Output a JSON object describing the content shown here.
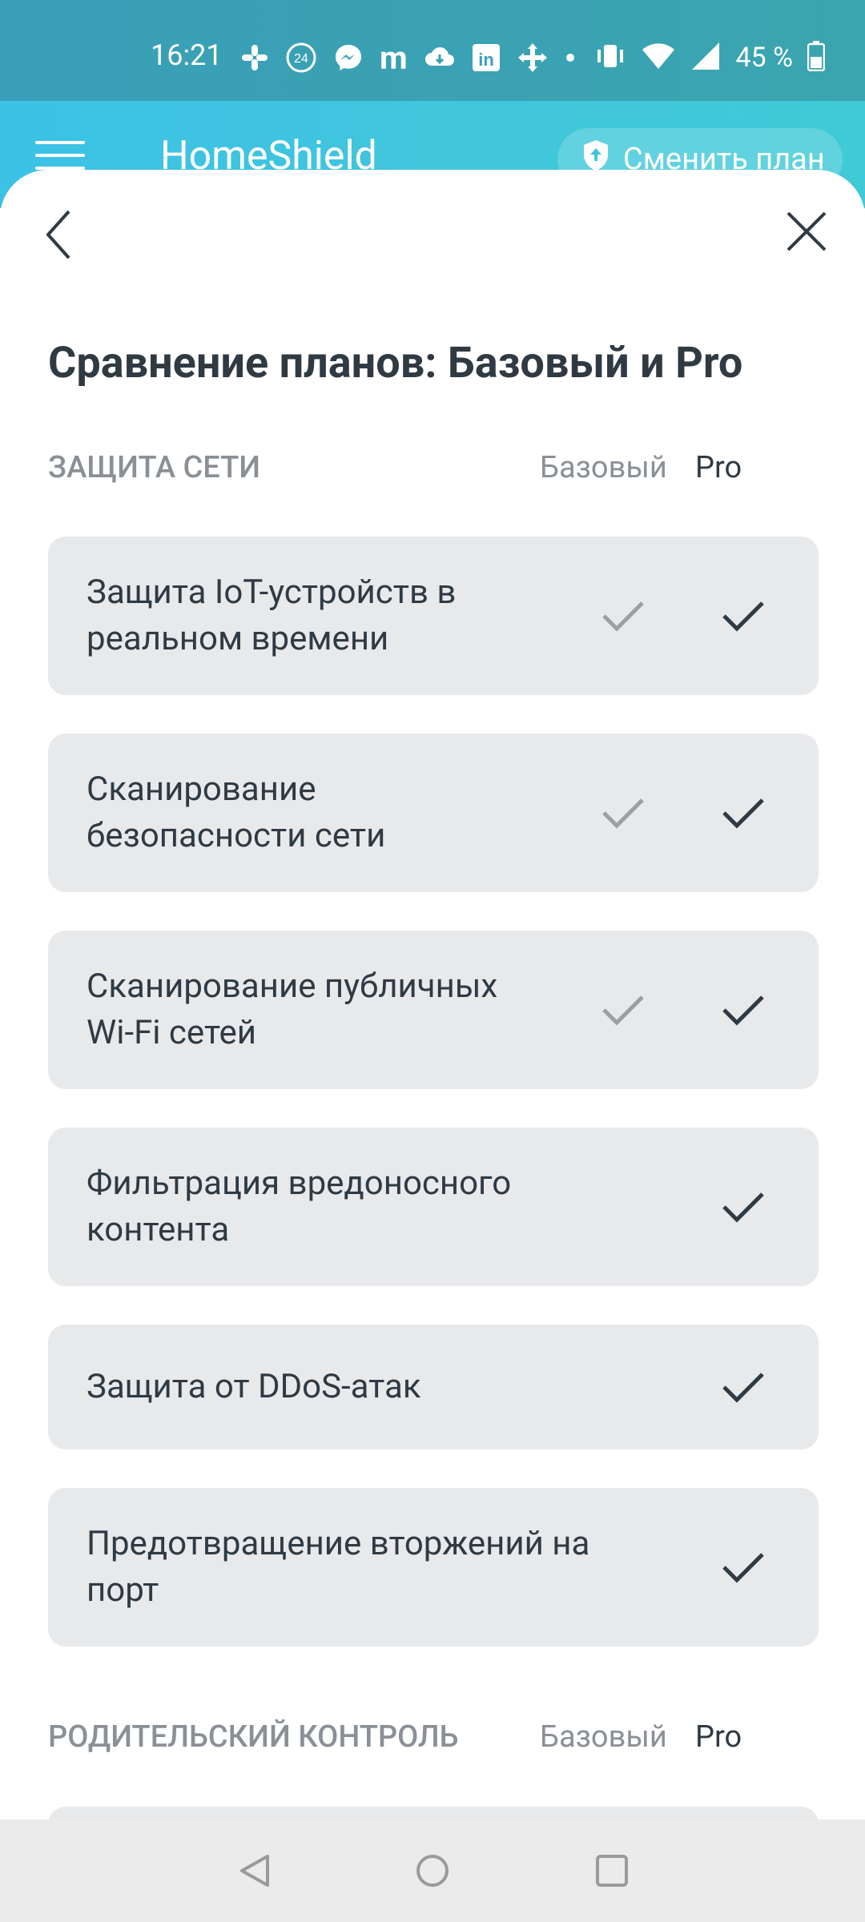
{
  "status_bar": {
    "time": "16:21",
    "notification_icons": [
      "slack-icon",
      "badge-24-icon",
      "messenger-icon",
      "m-icon",
      "cloud-icon",
      "linkedin-icon",
      "move-icon",
      "dot-icon"
    ],
    "badge_24": "24",
    "m_letter": "m",
    "linkedin_letters": "in",
    "battery_percent": "45 %"
  },
  "app_header": {
    "title": "HomeShield",
    "upgrade_button": "Сменить план"
  },
  "sheet": {
    "title": "Сравнение планов: Базовый и Pro",
    "sections": [
      {
        "title": "ЗАЩИТА СЕТИ",
        "col_basic": "Базовый",
        "col_pro": "Pro",
        "features": [
          {
            "label": "Защита IoT-устройств в реальном времени",
            "basic": true,
            "pro": true
          },
          {
            "label": "Сканирование безопасности сети",
            "basic": true,
            "pro": true
          },
          {
            "label": "Сканирование публичных Wi-Fi сетей",
            "basic": true,
            "pro": true
          },
          {
            "label": "Фильтрация вредоносного контента",
            "basic": false,
            "pro": true
          },
          {
            "label": "Защита от DDoS-атак",
            "basic": false,
            "pro": true
          },
          {
            "label": "Предотвращение вторжений на порт",
            "basic": false,
            "pro": true
          }
        ]
      },
      {
        "title": "РОДИТЕЛЬСКИЙ КОНТРОЛЬ",
        "col_basic": "Базовый",
        "col_pro": "Pro"
      }
    ]
  },
  "colors": {
    "header_gradient_start": "#3cc2e6",
    "header_gradient_end": "#3fcad6",
    "card_bg": "#e8e9eb",
    "text_primary": "#2f3a43",
    "text_secondary": "#8a9095",
    "check_basic": "#9aa0a4",
    "check_pro": "#2f3a43"
  }
}
